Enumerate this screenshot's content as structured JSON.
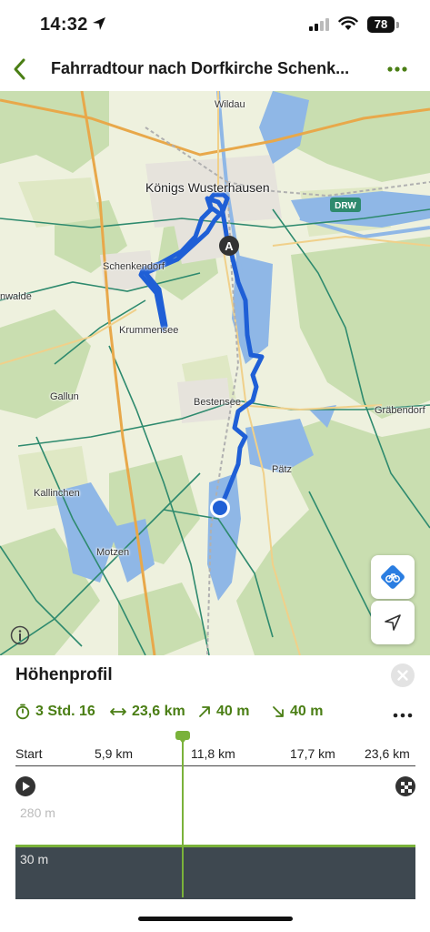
{
  "status_bar": {
    "time": "14:32",
    "battery": "78"
  },
  "nav": {
    "title": "Fahrradtour nach Dorfkirche Schenk...",
    "back_icon": "chevron-left-icon",
    "more_icon": "more-horizontal-icon"
  },
  "map": {
    "places": {
      "wildau": "Wildau",
      "koenigs_wusterhausen": "Königs Wusterhausen",
      "schenkendorf": "Schenkendorf",
      "krummensee": "Krummensee",
      "wernsdorf_partial": "nwalde",
      "gallun": "Gallun",
      "bestensee": "Bestensee",
      "graebendorf": "Gräbendorf",
      "paetz": "Pätz",
      "kallinchen": "Kallinchen",
      "motzen": "Motzen"
    },
    "route_badge": "DRW",
    "start_marker": "A",
    "colors": {
      "route": "#1f5fd6",
      "water": "#8fb7e6",
      "forest": "#c9deb0",
      "field": "#eef1de",
      "road": "#e8a84a",
      "rail": "#b0b0b0",
      "cycleway": "#2e8a6e"
    }
  },
  "profile": {
    "title": "Höhenprofil",
    "stats": {
      "duration": "3 Std. 16",
      "distance": "23,6 km",
      "ascent": "40 m",
      "descent": "40 m"
    },
    "distance_ticks": [
      "Start",
      "5,9 km",
      "11,8 km",
      "17,7 km",
      "23,6 km"
    ],
    "elevation_max": "280 m",
    "elevation_min": "30 m",
    "accent_color": "#7ab23a"
  }
}
